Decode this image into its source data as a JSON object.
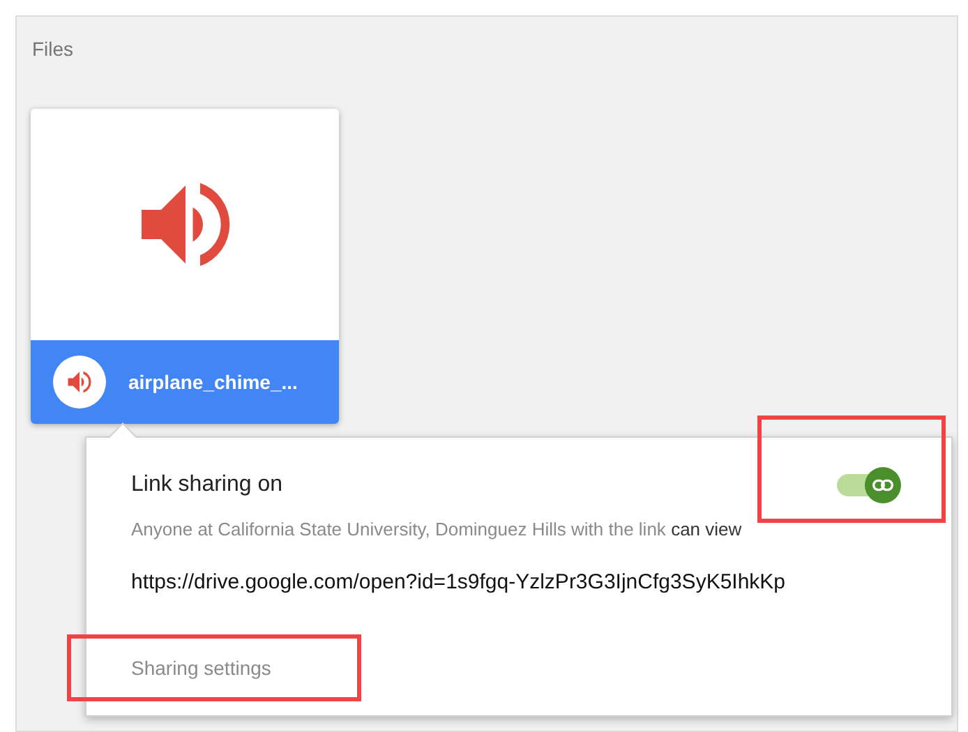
{
  "section_title": "Files",
  "file_card": {
    "name": "airplane_chime_...",
    "kind": "audio"
  },
  "share_popup": {
    "title": "Link sharing on",
    "toggle": {
      "on": true
    },
    "description": "Anyone at California State University, Dominguez Hills with the link",
    "permission": "can view",
    "link": "https://drive.google.com/open?id=1s9fgq-YzlzPr3G3IjnCfg3SyK5IhkKp",
    "settings_link": "Sharing settings"
  }
}
